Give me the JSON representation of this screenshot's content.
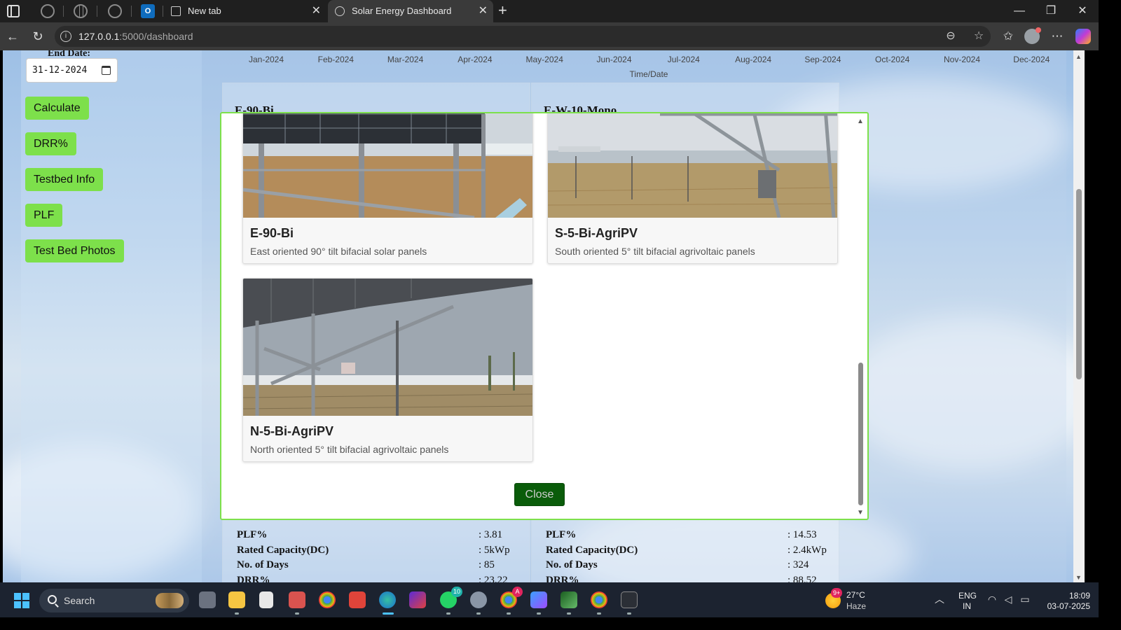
{
  "browser": {
    "tabs": [
      {
        "label": "New tab",
        "active": false
      },
      {
        "label": "Solar Energy Dashboard",
        "active": true
      }
    ],
    "tab_close_glyph": "✕",
    "new_tab_glyph": "+",
    "url_host": "127.0.0.1",
    "url_path": ":5000/dashboard",
    "window_controls": {
      "minimize": "—",
      "maximize": "❐",
      "close": "✕"
    }
  },
  "sidebar": {
    "end_date_label": "End Date:",
    "end_date_value": "31-12-2024",
    "buttons": [
      "Calculate",
      "DRR%",
      "Testbed Info",
      "PLF",
      "Test Bed Photos"
    ]
  },
  "chart_data": {
    "type": "line",
    "x_tick_labels": [
      "Jan-2024",
      "Feb-2024",
      "Mar-2024",
      "Apr-2024",
      "May-2024",
      "Jun-2024",
      "Jul-2024",
      "Aug-2024",
      "Sep-2024",
      "Oct-2024",
      "Nov-2024",
      "Dec-2024"
    ],
    "xlabel": "Time/Date"
  },
  "cards": [
    {
      "heading": "E-90-Bi",
      "stats": [
        {
          "label": "PLF%",
          "value": ": 3.81"
        },
        {
          "label": "Rated Capacity(DC)",
          "value": ": 5kWp"
        },
        {
          "label": "No. of Days",
          "value": ": 85"
        },
        {
          "label": "DRR%",
          "value": ": 23.22"
        }
      ]
    },
    {
      "heading": "E-W-10-Mono",
      "stats": [
        {
          "label": "PLF%",
          "value": ": 14.53"
        },
        {
          "label": "Rated Capacity(DC)",
          "value": ": 2.4kWp"
        },
        {
          "label": "No. of Days",
          "value": ": 324"
        },
        {
          "label": "DRR%",
          "value": ": 88.52"
        }
      ]
    }
  ],
  "modal": {
    "photos": [
      {
        "title": "E-90-Bi",
        "description": "East oriented 90° tilt bifacial solar panels"
      },
      {
        "title": "S-5-Bi-AgriPV",
        "description": "South oriented 5° tilt bifacial agrivoltaic panels"
      },
      {
        "title": "N-5-Bi-AgriPV",
        "description": "North oriented 5° tilt bifacial agrivoltaic panels"
      }
    ],
    "close_label": "Close"
  },
  "taskbar": {
    "search_label": "Search",
    "whatsapp_badge": "10",
    "chrome_badge": "A",
    "weather_badge": "9+",
    "temperature": "27°C",
    "condition": "Haze",
    "lang_line1": "ENG",
    "lang_line2": "IN",
    "time": "18:09",
    "date": "03-07-2025"
  },
  "colors": {
    "accent_green": "#7de04b",
    "close_button": "#0a5c0a",
    "taskbar": "#1c2330"
  }
}
